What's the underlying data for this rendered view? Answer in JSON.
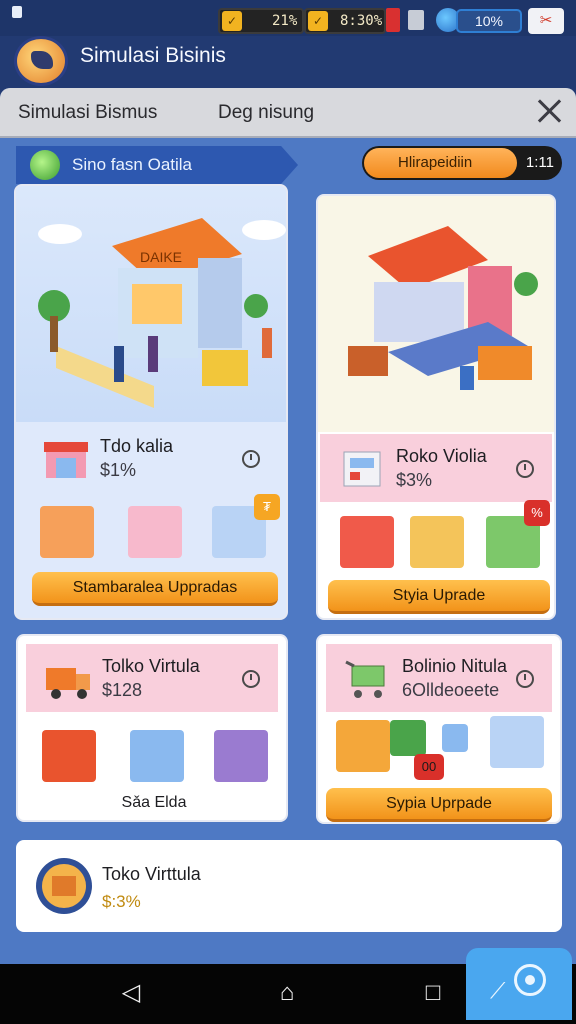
{
  "status_bar": {
    "stat1": "21%",
    "stat2": "8:30%",
    "battery": "10%"
  },
  "app": {
    "title": "Simulasi Bisinis"
  },
  "tabs": [
    {
      "label": "Simulasi Bismus"
    },
    {
      "label": "Deg nisung"
    }
  ],
  "ribbon": {
    "label": "Sino fasn Oatila"
  },
  "progress": {
    "label": "Hlirapeidiin",
    "counter": "1:11",
    "fraction": 0.78
  },
  "cards": {
    "a": {
      "shop_sign": "DAIKE",
      "name": "Tdo kalia",
      "value": "$1%",
      "badge": "₮",
      "button": "Stambaralea Uppradas"
    },
    "b": {
      "name": "Roko Violia",
      "value": "$3%",
      "badge": "%",
      "button": "Styia Uprade"
    },
    "c": {
      "name": "Tolko Virtula",
      "value": "$128",
      "footer": "Sǎa Elda"
    },
    "d": {
      "name": "Bolinio Nitula",
      "value": "6Olldeoeete",
      "badge": "00",
      "button": "Sypia Uprpade"
    },
    "e": {
      "name": "Toko Virttula",
      "value": "$:3%"
    }
  },
  "colors": {
    "accent_orange": "#f2931a",
    "panel_blue": "#4e79c4",
    "pink_row": "#f9cfdc"
  }
}
